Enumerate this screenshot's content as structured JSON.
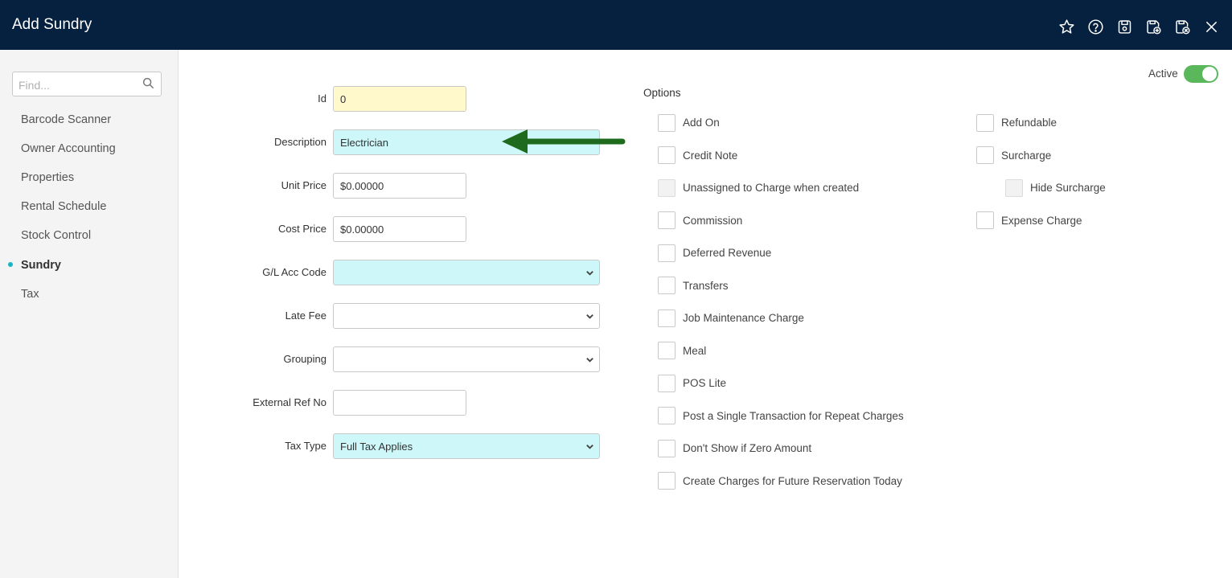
{
  "header": {
    "title": "Add Sundry",
    "icons": [
      "star-icon",
      "help-icon",
      "save-icon",
      "save-add-icon",
      "save-close-icon",
      "close-icon"
    ]
  },
  "sidebar": {
    "search_placeholder": "Find...",
    "items": [
      {
        "label": "Barcode Scanner"
      },
      {
        "label": "Owner Accounting"
      },
      {
        "label": "Properties"
      },
      {
        "label": "Rental Schedule"
      },
      {
        "label": "Stock Control"
      },
      {
        "label": "Sundry",
        "active": true
      },
      {
        "label": "Tax"
      }
    ]
  },
  "form": {
    "id": {
      "label": "Id",
      "value": "0"
    },
    "description": {
      "label": "Description",
      "value": "Electrician"
    },
    "unit_price": {
      "label": "Unit Price",
      "value": "$0.00000"
    },
    "cost_price": {
      "label": "Cost Price",
      "value": "$0.00000"
    },
    "gl_acc_code": {
      "label": "G/L Acc Code",
      "value": ""
    },
    "late_fee": {
      "label": "Late Fee",
      "value": ""
    },
    "grouping": {
      "label": "Grouping",
      "value": ""
    },
    "external_ref": {
      "label": "External Ref No",
      "value": ""
    },
    "tax_type": {
      "label": "Tax Type",
      "value": "Full Tax Applies"
    }
  },
  "options": {
    "title": "Options",
    "left": [
      {
        "label": "Add On",
        "checked": false
      },
      {
        "label": "Credit Note",
        "checked": false
      },
      {
        "label": "Unassigned to Charge when created",
        "checked": false,
        "disabled": true
      },
      {
        "label": "Commission",
        "checked": false
      },
      {
        "label": "Deferred Revenue",
        "checked": false
      },
      {
        "label": "Transfers",
        "checked": false
      },
      {
        "label": "Job Maintenance Charge",
        "checked": false
      },
      {
        "label": "Meal",
        "checked": false
      },
      {
        "label": "POS Lite",
        "checked": false
      },
      {
        "label": "Post a Single Transaction for Repeat Charges",
        "checked": false
      },
      {
        "label": "Don't Show if Zero Amount",
        "checked": false
      },
      {
        "label": "Create Charges for Future Reservation Today",
        "checked": false
      }
    ],
    "right": [
      {
        "label": "Refundable",
        "checked": false
      },
      {
        "label": "Surcharge",
        "checked": false
      },
      {
        "label": "Hide Surcharge",
        "checked": false,
        "disabled": true
      },
      {
        "label": "Expense Charge",
        "checked": false
      }
    ]
  },
  "active": {
    "label": "Active",
    "on": true
  },
  "colors": {
    "header_bg": "#06203f",
    "accent": "#19b3c6",
    "toggle_on": "#5bb75b",
    "arrow": "#1e6b1e"
  }
}
